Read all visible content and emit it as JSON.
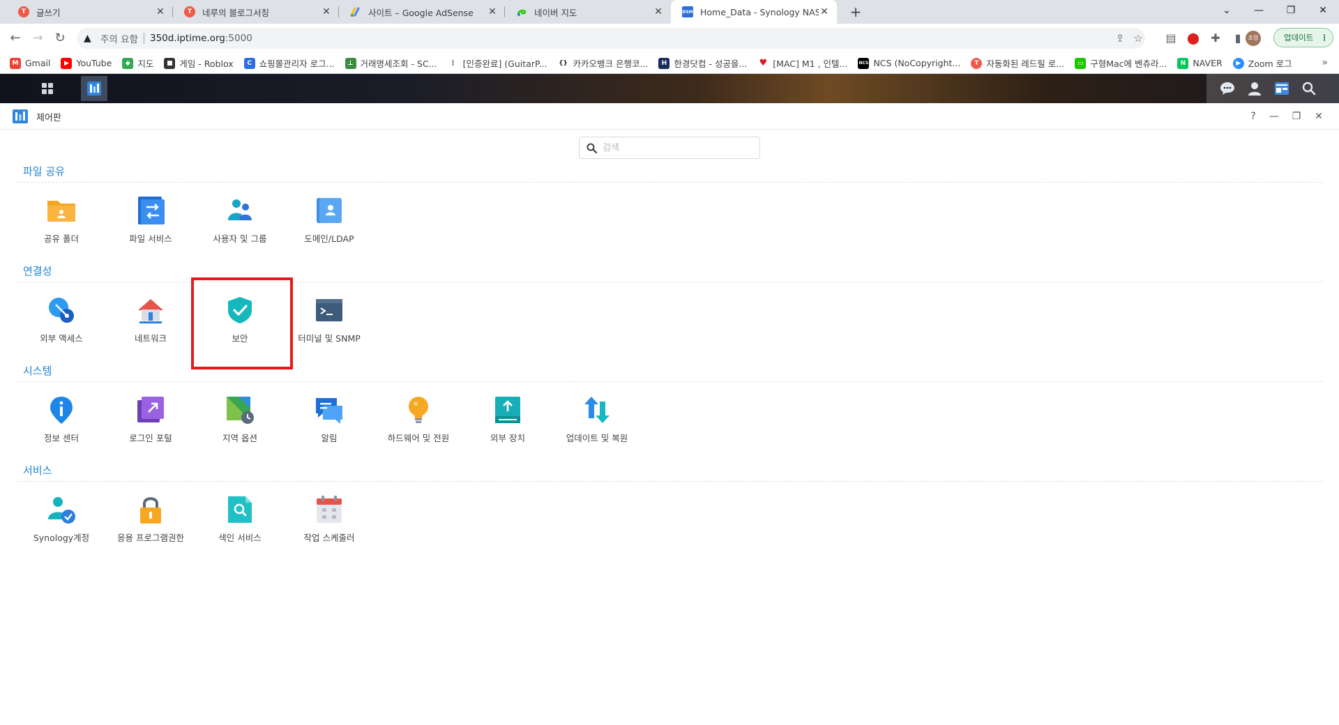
{
  "browser": {
    "tabs": [
      {
        "title": "글쓰기",
        "fav_color": "#f05a4a",
        "fav_text": "T"
      },
      {
        "title": "네루의 블로그서칭",
        "fav_color": "#f05a4a",
        "fav_text": "T"
      },
      {
        "title": "사이트 – Google AdSense",
        "fav_color": "#fbbc05",
        "fav_text": ""
      },
      {
        "title": "네이버 지도",
        "fav_color": "#1ec800",
        "fav_text": ""
      },
      {
        "title": "Home_Data - Synology NAS",
        "fav_color": "#2b6fd6",
        "fav_text": "DSM"
      }
    ],
    "address": {
      "warning": "주의 요함",
      "host": "350d.iptime.org",
      "port": ":5000"
    },
    "profile_initials": "조영",
    "update_label": "업데이트",
    "bookmarks": [
      {
        "label": "Gmail",
        "color": "#ea4335",
        "icon": "M"
      },
      {
        "label": "YouTube",
        "color": "#ff0000",
        "icon": "▶"
      },
      {
        "label": "지도",
        "color": "#34a853",
        "icon": "◆"
      },
      {
        "label": "게임 - Roblox",
        "color": "#333333",
        "icon": "■"
      },
      {
        "label": "쇼핑몰관리자 로그...",
        "color": "#2d6ee6",
        "icon": "C"
      },
      {
        "label": "거래명세조회 - SC...",
        "color": "#3d8c40",
        "icon": "⊥"
      },
      {
        "label": "[인증완료] (GuitarP...",
        "color": "#222222",
        "icon": "⋮"
      },
      {
        "label": "카카오뱅크 은행코...",
        "color": "#222222",
        "icon": "{}"
      },
      {
        "label": "한경닷컴 - 성공을...",
        "color": "#1a2a5a",
        "icon": "H"
      },
      {
        "label": "[MAC] M1 , 인텔...",
        "color": "#d81e2a",
        "icon": "♥"
      },
      {
        "label": "NCS (NoCopyright...",
        "color": "#000000",
        "icon": "NCS"
      },
      {
        "label": "자동화된 레드필 로...",
        "color": "#f05a4a",
        "icon": "T"
      },
      {
        "label": "구형Mac에 벤츄라...",
        "color": "#1ec800",
        "icon": "▭"
      },
      {
        "label": "NAVER",
        "color": "#03c75a",
        "icon": "N"
      },
      {
        "label": "Zoom 로그",
        "color": "#2d8cff",
        "icon": "▶"
      }
    ]
  },
  "control_panel": {
    "title": "제어판",
    "search_placeholder": "검색",
    "sections": [
      {
        "title": "파일 공유",
        "items": [
          {
            "label": "공유 폴더",
            "icon": "shared-folder-icon"
          },
          {
            "label": "파일 서비스",
            "icon": "file-services-icon"
          },
          {
            "label": "사용자 및 그룹",
            "icon": "user-group-icon"
          },
          {
            "label": "도메인/LDAP",
            "icon": "domain-ldap-icon"
          }
        ]
      },
      {
        "title": "연결성",
        "items": [
          {
            "label": "외부 액세스",
            "icon": "external-access-icon"
          },
          {
            "label": "네트워크",
            "icon": "network-icon"
          },
          {
            "label": "보안",
            "icon": "security-icon"
          },
          {
            "label": "터미널 및 SNMP",
            "icon": "terminal-icon"
          }
        ]
      },
      {
        "title": "시스템",
        "items": [
          {
            "label": "정보 센터",
            "icon": "info-center-icon"
          },
          {
            "label": "로그인 포털",
            "icon": "login-portal-icon"
          },
          {
            "label": "지역 옵션",
            "icon": "regional-options-icon"
          },
          {
            "label": "알림",
            "icon": "notification-icon"
          },
          {
            "label": "하드웨어 및 전원",
            "icon": "hardware-power-icon"
          },
          {
            "label": "외부 장치",
            "icon": "external-devices-icon"
          },
          {
            "label": "업데이트 및 복원",
            "icon": "update-restore-icon"
          }
        ]
      },
      {
        "title": "서비스",
        "items": [
          {
            "label": "Synology계정",
            "icon": "synology-account-icon"
          },
          {
            "label": "응용 프로그램권한",
            "icon": "app-privileges-icon"
          },
          {
            "label": "색인 서비스",
            "icon": "indexing-service-icon"
          },
          {
            "label": "작업 스케줄러",
            "icon": "task-scheduler-icon"
          }
        ]
      }
    ]
  }
}
